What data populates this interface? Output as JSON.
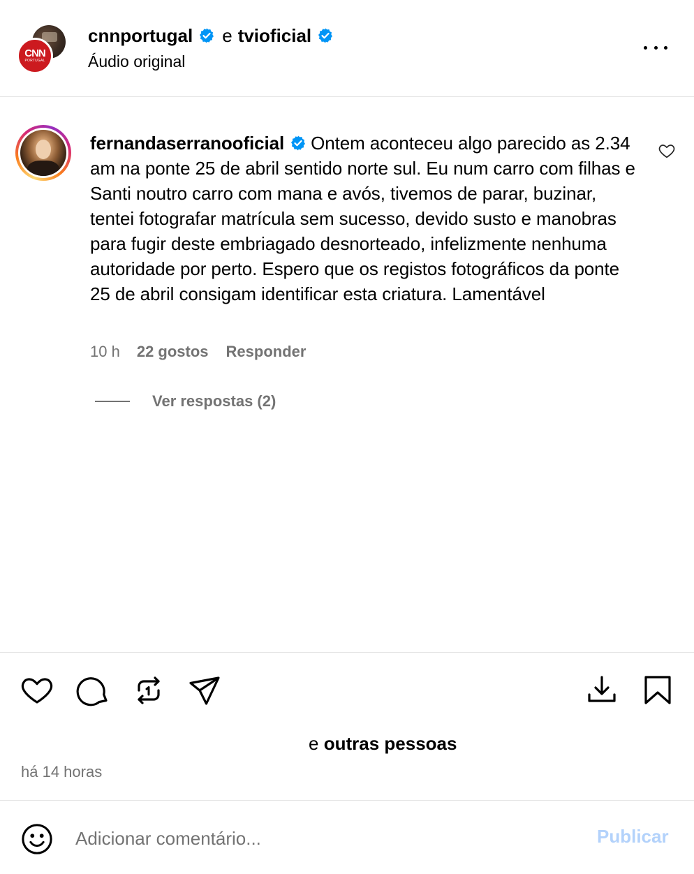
{
  "header": {
    "author_primary": "cnnportugal",
    "joiner": "e",
    "author_secondary": "tvioficial",
    "subtitle": "Áudio original",
    "logo_text": "CNN",
    "logo_subtext": "PORTUGAL"
  },
  "comment": {
    "username": "fernandaserranooficial",
    "text": "Ontem aconteceu algo parecido as 2.34 am na ponte 25 de abril sentido norte sul. Eu num carro com filhas e Santi noutro carro com mana e avós, tivemos de parar, buzinar, tentei fotografar matrícula sem sucesso, devido susto e manobras para fugir deste embriagado desnorteado, infelizmente nenhuma autoridade por perto. Espero que os registos fotográficos da ponte 25 de abril consigam identificar esta criatura. Lamentável",
    "time": "10 h",
    "likes": "22 gostos",
    "reply_label": "Responder",
    "view_replies": "Ver respostas (2)"
  },
  "post": {
    "likes_prefix": "e",
    "likes_suffix": "outras pessoas",
    "time": "há 14 horas"
  },
  "composer": {
    "placeholder": "Adicionar comentário...",
    "publish_label": "Publicar"
  },
  "colors": {
    "verified": "#0095f6",
    "meta_gray": "#737373",
    "publish_disabled": "#b3d2fb",
    "divider": "#e4e4e4",
    "cnn_red": "#cc1a1f"
  },
  "icons": [
    "more-icon",
    "verified-badge-icon",
    "heart-icon",
    "comment-icon",
    "repost-icon",
    "share-icon",
    "download-icon",
    "bookmark-icon",
    "emoji-icon"
  ]
}
